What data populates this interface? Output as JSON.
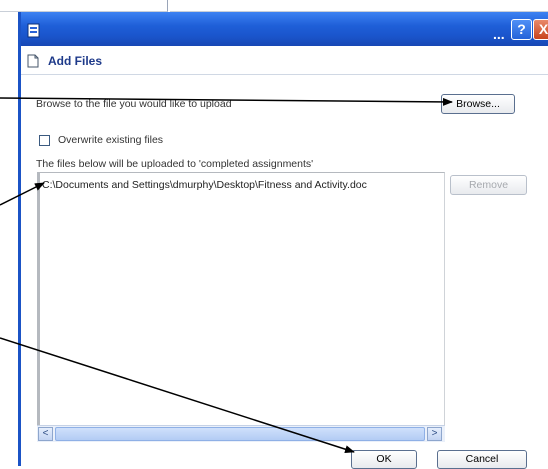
{
  "window": {
    "title_ellipsis": "...",
    "help_label": "?",
    "close_label": "X",
    "header_title": "Add Files"
  },
  "form": {
    "browse_prompt": "Browse to the file you would like to upload",
    "browse_label": "Browse...",
    "overwrite_label": "Overwrite existing files",
    "overwrite_checked": false,
    "upload_target_text": "The files below will be uploaded to 'completed assignments'",
    "remove_label": "Remove",
    "files": [
      "C:\\Documents and Settings\\dmurphy\\Desktop\\Fitness and Activity.doc"
    ]
  },
  "scrollbar": {
    "left_arrow": "<",
    "right_arrow": ">"
  },
  "footer": {
    "ok_label": "OK",
    "cancel_label": "Cancel"
  },
  "colors": {
    "titlebar": "#1f5fd8",
    "header_text": "#1e3a8a",
    "arrow": "#000000"
  },
  "icons": [
    "app-icon",
    "document-icon",
    "help-icon",
    "close-icon"
  ]
}
